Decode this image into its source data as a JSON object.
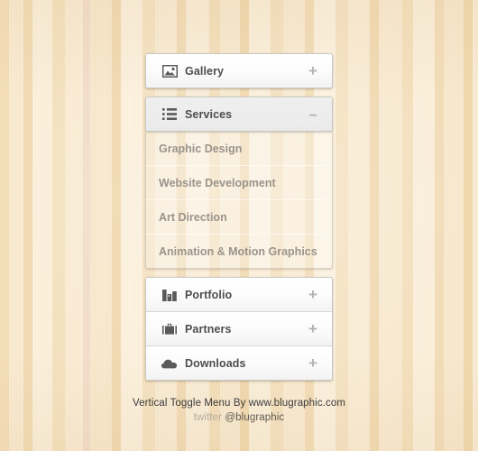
{
  "menu": {
    "groups": [
      {
        "id": "gallery",
        "label": "Gallery",
        "icon": "image-icon",
        "toggle": "+",
        "open": false,
        "items": []
      },
      {
        "id": "services",
        "label": "Services",
        "icon": "list-icon",
        "toggle": "–",
        "open": true,
        "items": [
          {
            "label": "Graphic Design"
          },
          {
            "label": "Website Development"
          },
          {
            "label": "Art Direction"
          },
          {
            "label": "Animation & Motion Graphics"
          }
        ]
      },
      {
        "id": "portfolio",
        "label": "Portfolio",
        "icon": "bar-chart-icon",
        "toggle": "+",
        "open": false,
        "items": []
      },
      {
        "id": "partners",
        "label": "Partners",
        "icon": "briefcase-icon",
        "toggle": "+",
        "open": false,
        "items": []
      },
      {
        "id": "downloads",
        "label": "Downloads",
        "icon": "cloud-icon",
        "toggle": "+",
        "open": false,
        "items": []
      }
    ]
  },
  "footer": {
    "line1": "Vertical Toggle Menu By www.blugraphic.com",
    "twitter_word": "twitter",
    "twitter_handle": "@blugraphic"
  },
  "colors": {
    "wood_base": "#f6e3c3",
    "row_text": "#4d4d4d",
    "subitem_text": "#9a948c",
    "toggle": "#b2b2b2",
    "icon": "#5a5a5a"
  }
}
